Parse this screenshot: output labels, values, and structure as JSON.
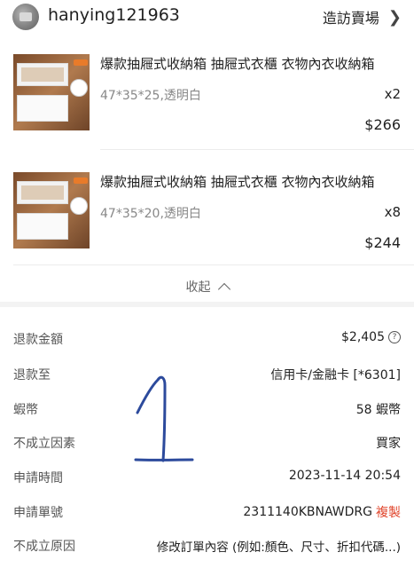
{
  "header": {
    "shop_name": "hanying121963",
    "visit_label": "造訪賣場",
    "avatar_icon": "shop-avatar",
    "chevron_icon": "chevron-right-icon"
  },
  "products": [
    {
      "title": "爆款抽屜式收納箱 抽屜式衣櫃  衣物內衣收納箱",
      "variation": "47*35*25,透明白",
      "quantity": "x2",
      "price": "$266"
    },
    {
      "title": "爆款抽屜式收納箱 抽屜式衣櫃  衣物內衣收納箱",
      "variation": "47*35*20,透明白",
      "quantity": "x8",
      "price": "$244"
    }
  ],
  "collapse": {
    "label": "收起",
    "icon": "chevron-up-icon"
  },
  "details": {
    "refund_amount": {
      "label": "退款金額",
      "value": "$2,405",
      "icon": "help-circle-icon",
      "icon_glyph": "?"
    },
    "refund_to": {
      "label": "退款至",
      "value": "信用卡/金融卡 [*6301]"
    },
    "shopee_coins": {
      "label": "蝦幣",
      "value": "58 蝦幣"
    },
    "cancelled_by": {
      "label": "不成立因素",
      "value": "買家"
    },
    "request_time": {
      "label": "申請時間",
      "value": "2023-11-14 20:54"
    },
    "request_no": {
      "label": "申請單號",
      "value": "2311140KBNAWDRG",
      "copy_label": "複製"
    },
    "cancel_reason": {
      "label": "不成立原因",
      "value": "修改訂單內容 (例如:顏色、尺寸、折扣代碼...)"
    }
  },
  "colors": {
    "accent": "#e0452b",
    "text": "#222222",
    "muted": "#888888",
    "scribble": "#2c4a9c"
  }
}
